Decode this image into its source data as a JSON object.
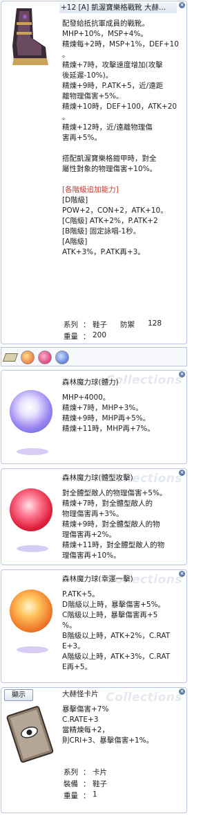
{
  "boots": {
    "title": "+12 [A] 凱渥寶樂格戰靴 大赫...",
    "lines": [
      "配發給抵抗軍成員的戰靴。",
      "MHP+10%，MSP+4%。",
      "精煉每+2時，MSP+1%，DEF+10",
      "。",
      "精煉+7時，攻擊速度增加(攻擊",
      "後延遲-10%)。",
      "精煉+9時，P.ATK+5，近/遠距",
      "離物理傷害+5%。",
      "精煉+10時，DEF+100，ATK+20",
      "。",
      "精煉+12時，近/遠離物理傷",
      "害再+5%。",
      "",
      "搭配凱渥寶樂格鎧甲時，對全",
      "屬性對象的物理傷害+10%。",
      "",
      "[各階級追加能力]",
      "[D階級]",
      " POW+2，CON+2，ATK+10。",
      "[C階級] ATK+2%，P.ATK+2",
      "[B階級] 固定詠唱-1秒。",
      "[A階級]",
      " ATK+3%，P.ATK再+3。"
    ],
    "type_label": "系列",
    "type_value": "鞋子",
    "defense_label": "防禦",
    "defense_value": "128",
    "weight_label": "重量",
    "weight_value": "200"
  },
  "orb1": {
    "title": "森林魔力球(體力)",
    "watermark": "Collections",
    "lines": [
      "MHP+4000。",
      "精煉+7時，MHP+3%。",
      "精煉+9時，MHP再+5%。",
      "精煉+11時，MHP再+7%。"
    ]
  },
  "orb2": {
    "title": "森林魔力球(體型攻擊)",
    "watermark": "Collections",
    "lines": [
      "對全體型敵人的物理傷害+5%。",
      "精煉+7時，對全體型敵人的",
      "物理傷害再+3%。",
      "精煉+9時，對全體型敵人的物",
      "理傷害再+2%。",
      "精煉+11時，對全體型敵人的物",
      "理傷害再+10%。"
    ]
  },
  "orb3": {
    "title": "森林魔力球(幸運一擊)",
    "watermark": "Collections",
    "lines": [
      "P.ATK+5。",
      "D階級以上時，暴擊傷害+5%。",
      "C階級以上時，暴擊傷害再+5",
      "%。",
      "B階級以上時，ATK+2%，C.RAT",
      "E+3。",
      "A階級以上時，ATK+3%，C.RAT",
      "E再+5。"
    ]
  },
  "card": {
    "show_button": "顯示",
    "title": "大赫怪卡片",
    "watermark": "Collections",
    "lines": [
      "暴擊傷害+7%",
      "C.RATE+3",
      "當精煉每+2，",
      "則CRI+3、暴擊傷害+1%。"
    ],
    "type_label": "系列",
    "type_value": "卡片",
    "equip_label": "裝備",
    "equip_value": "鞋子",
    "weight_label": "重量",
    "weight_value": "1"
  },
  "colors": {
    "border": "#b9c6dd",
    "accent_red": "#c0392b"
  }
}
